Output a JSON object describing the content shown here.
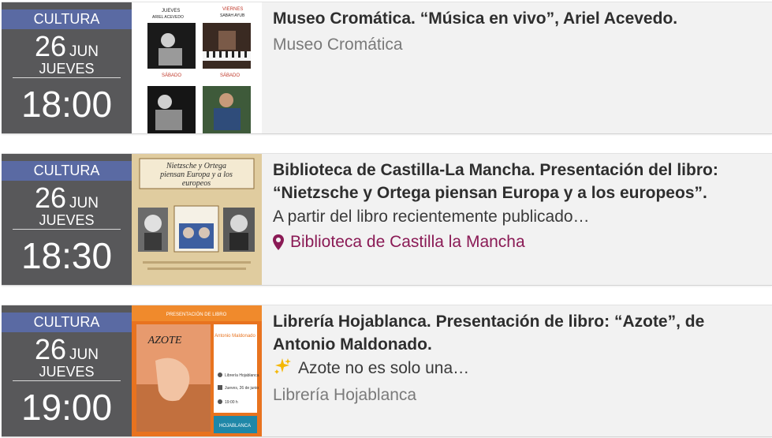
{
  "events": [
    {
      "category": "CULTURA",
      "day": "26",
      "month": "JUN",
      "weekday": "JUEVES",
      "time": "18:00",
      "image_alt": "Cartel Música en vivo",
      "title": "Museo Cromática. “Música en vivo”, Ariel Acevedo.",
      "venue": "Museo Cromática"
    },
    {
      "category": "CULTURA",
      "day": "26",
      "month": "JUN",
      "weekday": "JUEVES",
      "time": "18:30",
      "image_alt": "Cartel Nietzsche y Ortega piensan Europa y a los europeos",
      "title": "Biblioteca de Castilla-La Mancha. Presentación del libro: “Nietzsche y Ortega piensan Europa y a los europeos”.",
      "description": "A partir del libro recientemente publicado…",
      "location": "Biblioteca de Castilla la Mancha"
    },
    {
      "category": "CULTURA",
      "day": "26",
      "month": "JUN",
      "weekday": "JUEVES",
      "time": "19:00",
      "image_alt": "Cartel Azote",
      "title": "Librería Hojablanca. Presentación de libro: “Azote”, de Antonio Maldonado.",
      "description": "Azote no es solo una…",
      "venue": "Librería Hojablanca"
    }
  ],
  "poster1": {
    "col1_day": "JUEVES",
    "col1_name": "ARIEL ACEVEDO",
    "col2_day": "VIERNES",
    "col2_name": "SABAH AYUB",
    "col1b_day": "SÁBADO",
    "col2b_day": "SÁBADO"
  },
  "poster2": {
    "title_line1": "Nietzsche y Ortega",
    "title_line2": "piensan Europa y a los",
    "title_line3": "europeos"
  },
  "poster3": {
    "header": "PRESENTACIÓN DE LIBRO",
    "book_title": "AZOTE",
    "author": "Antonio Maldonado",
    "place": "Librería Hojablanca",
    "date": "Jueves, 26 de junio",
    "hour": "19:00 h",
    "brand": "HOJABLANCA"
  },
  "colors": {
    "date_bg": "#58585a",
    "category_bg": "#5a6aa3",
    "location_color": "#8a1a55"
  }
}
